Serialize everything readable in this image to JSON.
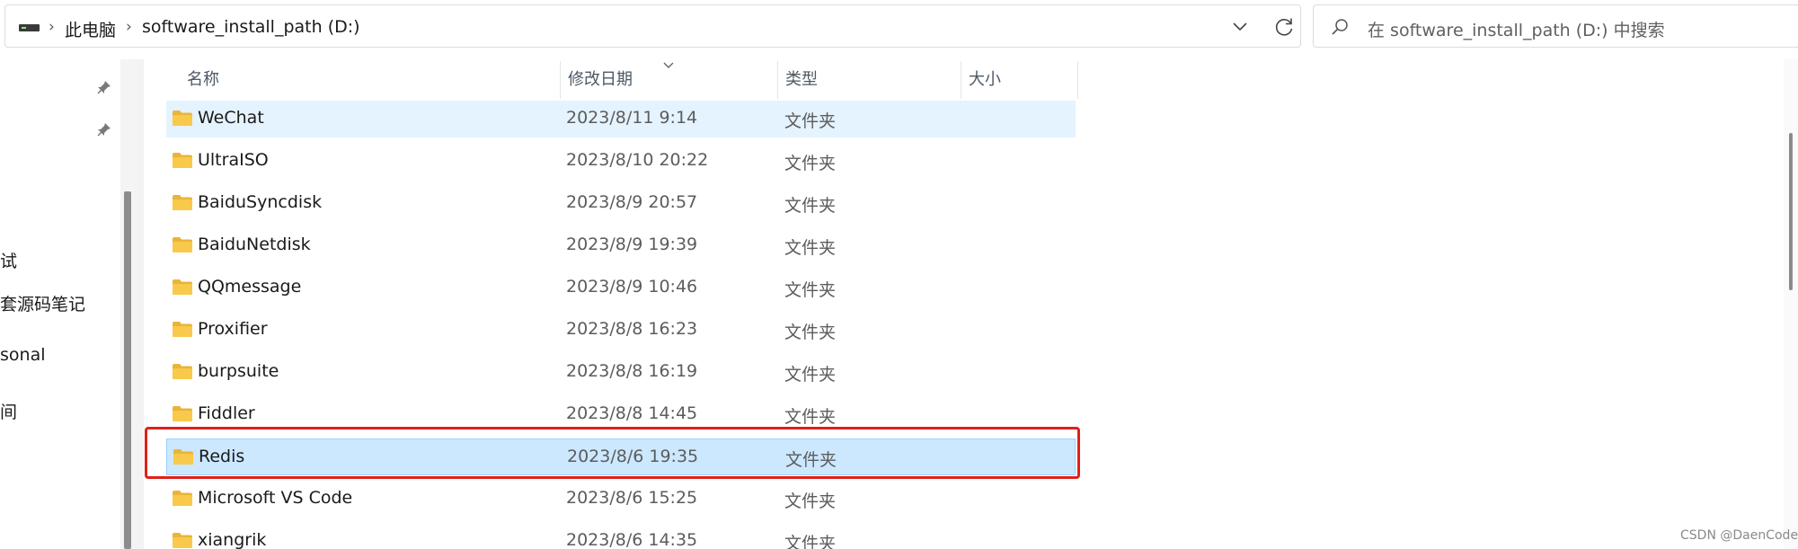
{
  "breadcrumb": {
    "items": [
      "此电脑",
      "software_install_path (D:)"
    ],
    "separator": "›"
  },
  "search": {
    "placeholder": "在 software_install_path (D:) 中搜索"
  },
  "nav": {
    "items": [
      "试",
      "套源码笔记",
      "sonal",
      "间"
    ]
  },
  "columns": {
    "name": "名称",
    "date": "修改日期",
    "type": "类型",
    "size": "大小"
  },
  "files": [
    {
      "name": "WeChat",
      "date": "2023/8/11 9:14",
      "type": "文件夹"
    },
    {
      "name": "UltraISO",
      "date": "2023/8/10 20:22",
      "type": "文件夹"
    },
    {
      "name": "BaiduSyncdisk",
      "date": "2023/8/9 20:57",
      "type": "文件夹"
    },
    {
      "name": "BaiduNetdisk",
      "date": "2023/8/9 19:39",
      "type": "文件夹"
    },
    {
      "name": "QQmessage",
      "date": "2023/8/9 10:46",
      "type": "文件夹"
    },
    {
      "name": "Proxifier",
      "date": "2023/8/8 16:23",
      "type": "文件夹"
    },
    {
      "name": "burpsuite",
      "date": "2023/8/8 16:19",
      "type": "文件夹"
    },
    {
      "name": "Fiddler",
      "date": "2023/8/8 14:45",
      "type": "文件夹"
    },
    {
      "name": "Redis",
      "date": "2023/8/6 19:35",
      "type": "文件夹"
    },
    {
      "name": "Microsoft VS Code",
      "date": "2023/8/6 15:25",
      "type": "文件夹"
    },
    {
      "name": "xiangrik",
      "date": "2023/8/6 14:35",
      "type": "文件夹"
    }
  ],
  "watermark": "CSDN @DaenCode",
  "colors": {
    "highlight_border": "#e0201a",
    "selected_bg": "#cce8ff",
    "hover_bg": "#e5f3ff",
    "folder_yellow": "#f8c94a"
  },
  "icons": [
    "drive-icon",
    "chevron-down-icon",
    "refresh-icon",
    "search-icon",
    "pin-icon",
    "folder-icon",
    "sort-arrow-icon"
  ]
}
